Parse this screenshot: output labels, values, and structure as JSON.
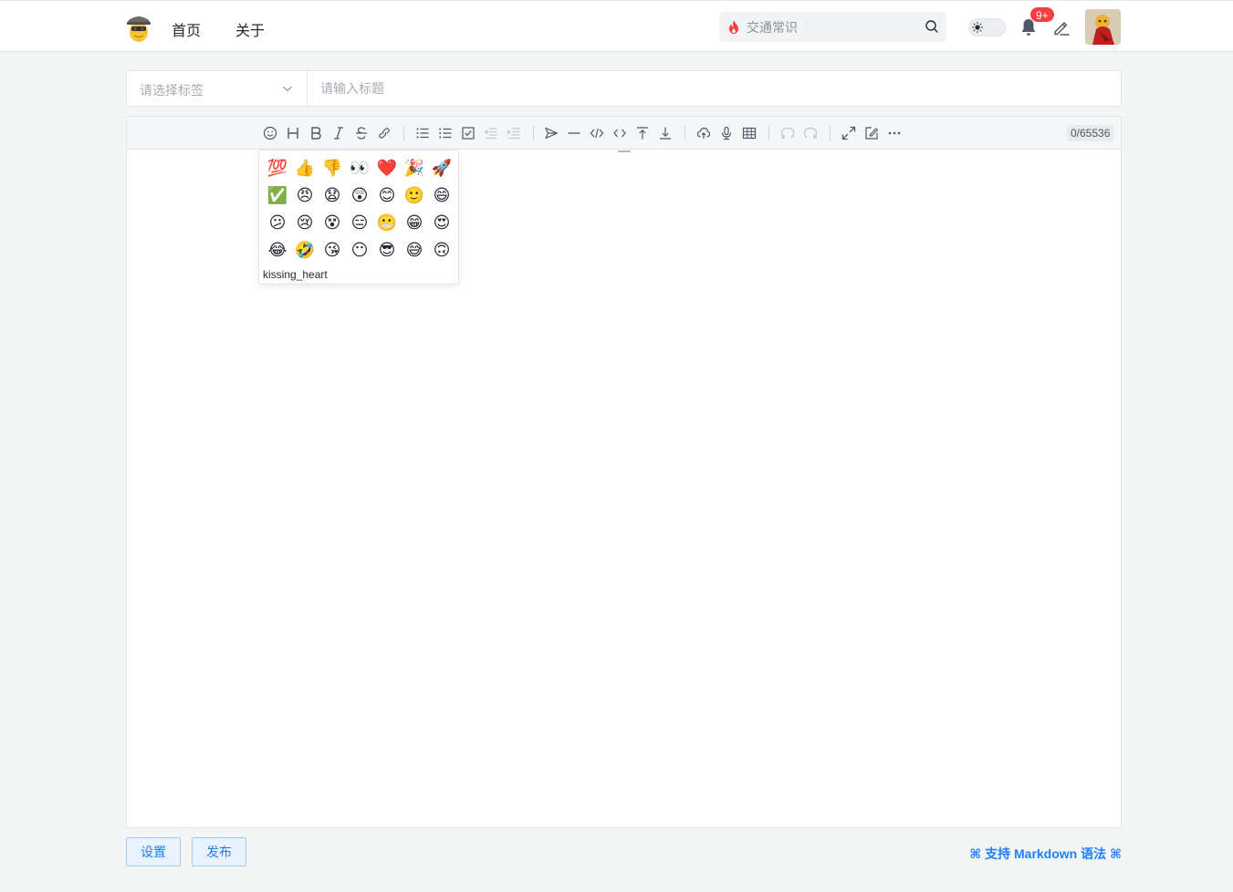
{
  "header": {
    "nav": {
      "home": "首页",
      "about": "关于"
    },
    "search": {
      "placeholder": "交通常识",
      "value": ""
    },
    "notifications_badge": "9+",
    "icons": [
      "logo-icon",
      "fire-icon",
      "search-icon",
      "sun-icon",
      "bell-icon",
      "pen-icon",
      "avatar"
    ]
  },
  "title_row": {
    "tag_placeholder": "请选择标签",
    "title_placeholder": "请输入标题",
    "title_value": ""
  },
  "toolbar": {
    "buttons": [
      "emoji",
      "headings",
      "bold",
      "italic",
      "strike",
      "link",
      "list",
      "ordered-list",
      "check",
      "outdent",
      "indent",
      "quote",
      "line",
      "code",
      "inline-code",
      "insert-before",
      "insert-after",
      "upload",
      "record",
      "table",
      "undo",
      "redo",
      "fullscreen",
      "edit-mode",
      "more"
    ],
    "counter": "0/65536"
  },
  "emoji_panel": {
    "rows": [
      [
        "💯",
        "👍",
        "👎",
        "👀",
        "❤️",
        "🎉",
        "🚀"
      ],
      [
        "✅",
        "😠",
        "😧",
        "😲",
        "😊",
        "🙂",
        "😄"
      ],
      [
        "😕",
        "😢",
        "😵",
        "😑",
        "😬",
        "😁",
        "😍"
      ],
      [
        "😂",
        "🤣",
        "😘",
        "😶",
        "😎",
        "😅",
        "🙃"
      ]
    ],
    "hover_name": "kissing_heart"
  },
  "footer": {
    "settings_label": "设置",
    "publish_label": "发布",
    "markdown_hint": "⌘ 支持 Markdown 语法 ⌘"
  },
  "colors": {
    "accent": "#1e80ff",
    "badge": "#f53f3f",
    "page_bg": "#f4f5f5",
    "toolbar_bg": "#f5f6f7"
  }
}
